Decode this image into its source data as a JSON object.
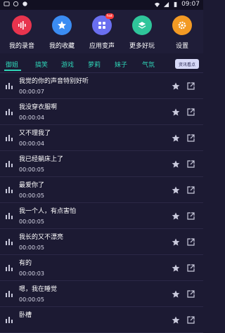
{
  "status": {
    "time": "09:07"
  },
  "quick": [
    {
      "label": "我的录音",
      "icon": "voice-record-icon",
      "color": "#e8344e"
    },
    {
      "label": "我的收藏",
      "icon": "star-favorite-icon",
      "color": "#3b8cf2"
    },
    {
      "label": "应用变声",
      "icon": "apps-grid-icon",
      "color": "#6a6ff0",
      "badge": "hot"
    },
    {
      "label": "更多好玩",
      "icon": "layers-icon",
      "color": "#2fc59a"
    },
    {
      "label": "设置",
      "icon": "gear-icon",
      "color": "#f39a24"
    }
  ],
  "tabs": [
    "御姐",
    "搞笑",
    "游戏",
    "萝莉",
    "妹子",
    "气氛"
  ],
  "news_button": "资讯看点",
  "items": [
    {
      "title": "我觉的你的声音特别好听",
      "time": "00:00:07"
    },
    {
      "title": "我没穿衣服啊",
      "time": "00:00:04"
    },
    {
      "title": "又不理我了",
      "time": "00:00:04"
    },
    {
      "title": "我已经躺床上了",
      "time": "00:00:05"
    },
    {
      "title": "最爱你了",
      "time": "00:00:05"
    },
    {
      "title": "我一个人，有点害怕",
      "time": "00:00:05"
    },
    {
      "title": "我长的又不漂亮",
      "time": "00:00:05"
    },
    {
      "title": "有的",
      "time": "00:00:03"
    },
    {
      "title": "嗯，我在睡觉",
      "time": "00:00:05"
    },
    {
      "title": "卧槽",
      "time": ""
    }
  ]
}
